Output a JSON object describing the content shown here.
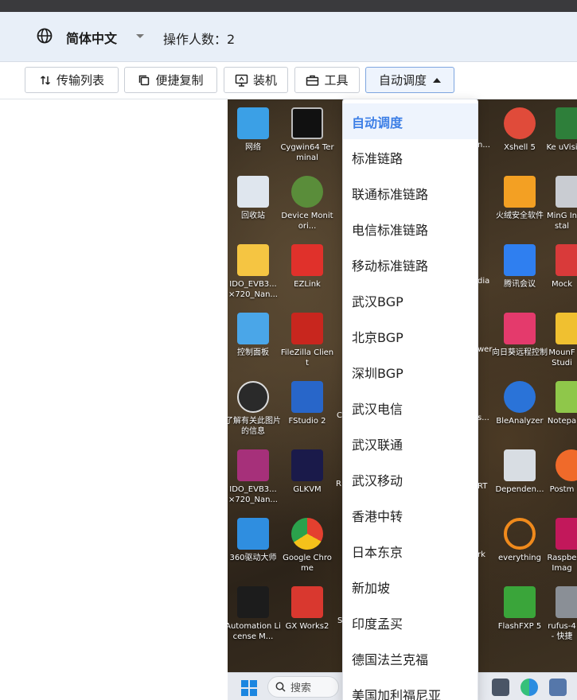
{
  "header": {
    "language": "简体中文",
    "operator_count_label": "操作人数：2"
  },
  "toolbar": {
    "transfer_list": "传输列表",
    "quick_copy": "便捷复制",
    "install": "装机",
    "tools": "工具",
    "auto_schedule": "自动调度"
  },
  "dropdown": {
    "selected": "自动调度",
    "items": [
      "自动调度",
      "标准链路",
      "联通标准链路",
      "电信标准链路",
      "移动标准链路",
      "武汉BGP",
      "北京BGP",
      "深圳BGP",
      "武汉电信",
      "武汉联通",
      "武汉移动",
      "香港中转",
      "日本东京",
      "新加坡",
      "印度孟买",
      "德国法兰克福",
      "美国加利福尼亚"
    ]
  },
  "desktop": {
    "col1": [
      "网络",
      "回收站",
      "IDO_EVB3... ×720_Nan...",
      "控制面板",
      "了解有关此图片的信息",
      "IDO_EVB3... ×720_Nan...",
      "360驱动大师",
      "Automation License M..."
    ],
    "col2": [
      "Cygwin64 Terminal",
      "Device Monitori...",
      "EZLink",
      "FileZilla Client",
      "FStudio 2",
      "GLKVM",
      "Google Chrome",
      "GX Works2"
    ],
    "col3_partial": [
      "C",
      "RI",
      "S"
    ],
    "col4_partial": [
      "n...",
      "dia",
      "wer",
      "s...",
      "RT",
      "rk"
    ],
    "col5": [
      "Xshell 5",
      "火绒安全软件",
      "腾讯会议",
      "向日葵远程控制",
      "BleAnalyzer",
      "Dependen...",
      "everything",
      "FlashFXP 5"
    ],
    "col6_partial": [
      "Ke uVisi",
      "MinG Instal",
      "Mock",
      "MounF Studi",
      "Notepa",
      "Postm",
      "Raspbe Imag",
      "rufus-4 - 快捷"
    ]
  },
  "taskbar": {
    "search_placeholder": "搜索"
  },
  "colors": {
    "header_bg": "#e8eff8",
    "accent": "#3d7fe6",
    "selected_bg": "#eef4fd",
    "top_strip": "#3a3a3d"
  }
}
